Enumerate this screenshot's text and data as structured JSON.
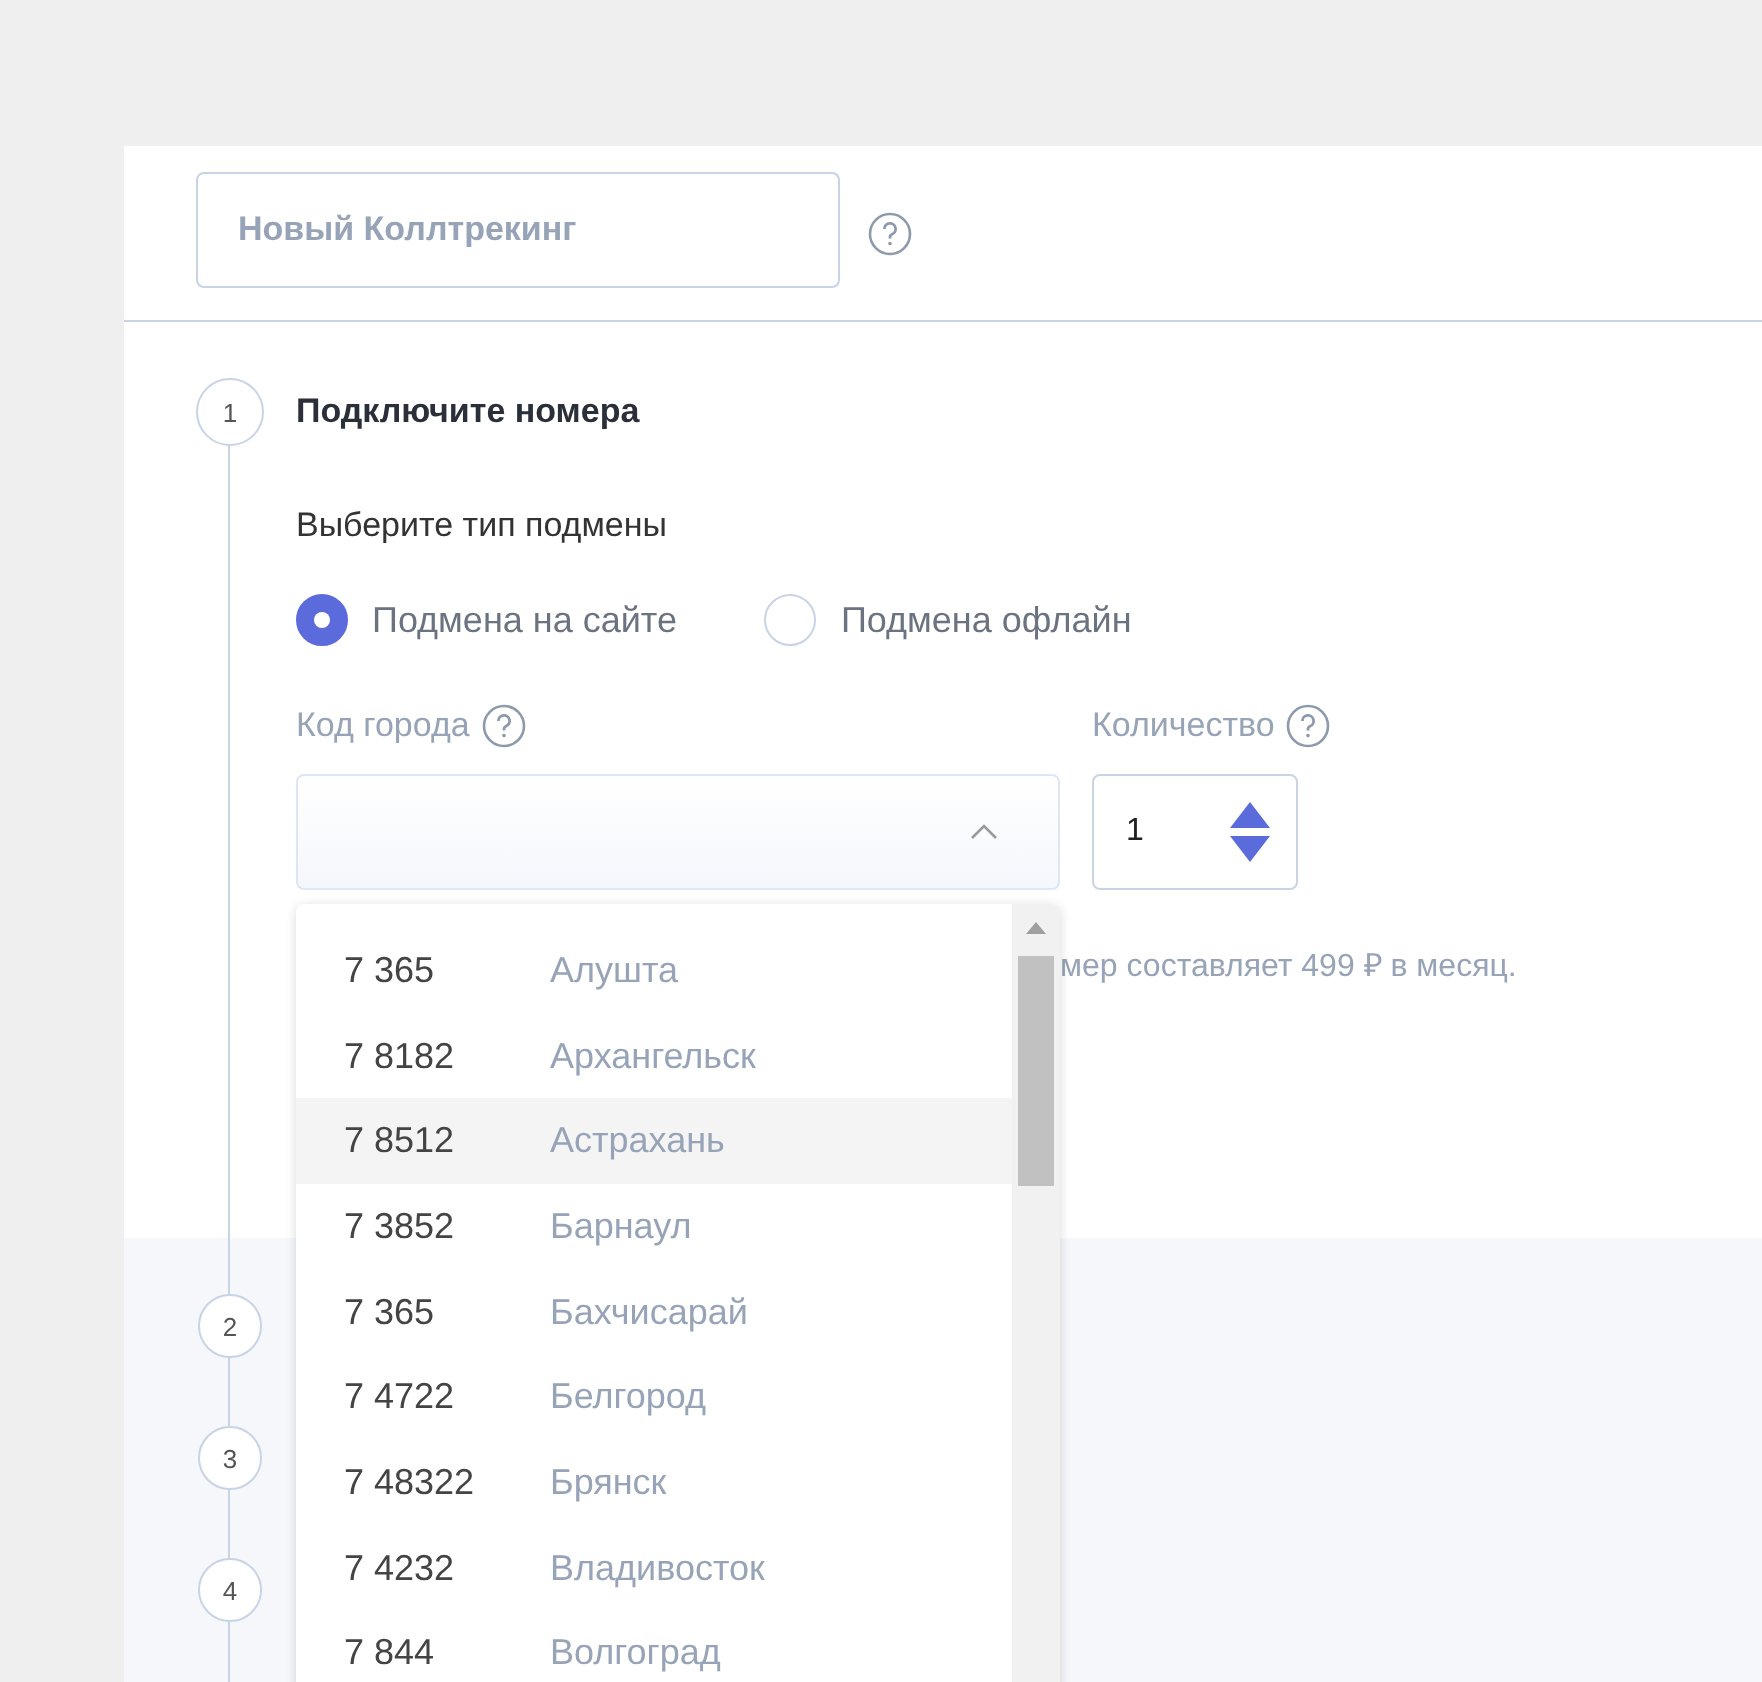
{
  "name_field": {
    "placeholder": "Новый Коллтрекинг"
  },
  "steps": [
    {
      "number": "1",
      "title": "Подключите номера"
    },
    {
      "number": "2"
    },
    {
      "number": "3"
    },
    {
      "number": "4"
    }
  ],
  "substitution": {
    "label": "Выберите тип подмены",
    "options": [
      {
        "label": "Подмена на сайте",
        "selected": true
      },
      {
        "label": "Подмена офлайн",
        "selected": false
      }
    ]
  },
  "city_code": {
    "label": "Код города",
    "expanded": true
  },
  "quantity": {
    "label": "Количество",
    "value": "1"
  },
  "price_note": "мер составляет 499 ₽ в месяц.",
  "city_options": [
    {
      "code": "7 365",
      "city": "Алушта",
      "selected": false
    },
    {
      "code": "7 8182",
      "city": "Архангельск",
      "selected": false
    },
    {
      "code": "7 8512",
      "city": "Астрахань",
      "selected": true
    },
    {
      "code": "7 3852",
      "city": "Барнаул",
      "selected": false
    },
    {
      "code": "7 365",
      "city": "Бахчисарай",
      "selected": false
    },
    {
      "code": "7 4722",
      "city": "Белгород",
      "selected": false
    },
    {
      "code": "7 48322",
      "city": "Брянск",
      "selected": false
    },
    {
      "code": "7 4232",
      "city": "Владивосток",
      "selected": false
    },
    {
      "code": "7 844",
      "city": "Волгоград",
      "selected": false
    }
  ]
}
